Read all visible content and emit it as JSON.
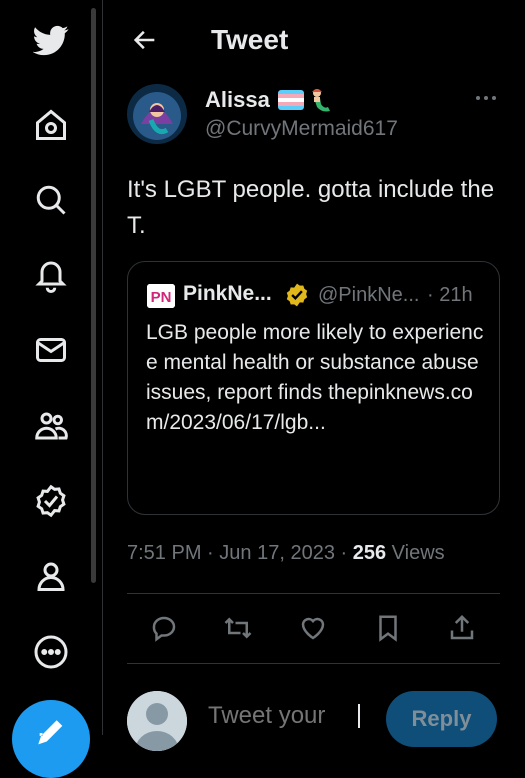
{
  "header": {
    "title": "Tweet"
  },
  "sidebar": {
    "items": [
      {
        "name": "twitter-logo-icon"
      },
      {
        "name": "home-icon"
      },
      {
        "name": "explore-icon"
      },
      {
        "name": "notifications-icon"
      },
      {
        "name": "messages-icon"
      },
      {
        "name": "communities-icon"
      },
      {
        "name": "verified-icon"
      },
      {
        "name": "profile-icon"
      },
      {
        "name": "more-icon"
      },
      {
        "name": "compose-tweet-icon"
      }
    ]
  },
  "tweet": {
    "author_name": "Alissa",
    "author_handle": "@CurvyMermaid617",
    "text": "It's LGBT people. gotta include the T.",
    "time": "7:51 PM",
    "date": "Jun 17, 2023",
    "views_count": "256",
    "views_label": "Views",
    "separator": "·"
  },
  "quote": {
    "name": "PinkNe...",
    "handle": "@PinkNe...",
    "time": "· 21h",
    "logo_text": "PN",
    "text": "LGB people more likely to experience mental health or substance abuse issues, report finds thepinknews.com/2023/06/17/lgb..."
  },
  "reply": {
    "placeholder": "Tweet your",
    "button_label": "Reply"
  },
  "colors": {
    "background": "#000000",
    "text": "#e7e9ea",
    "muted": "#71767b",
    "border": "#2f3336",
    "accent": "#1d9bf0",
    "verified_gold": "#e2b719"
  }
}
